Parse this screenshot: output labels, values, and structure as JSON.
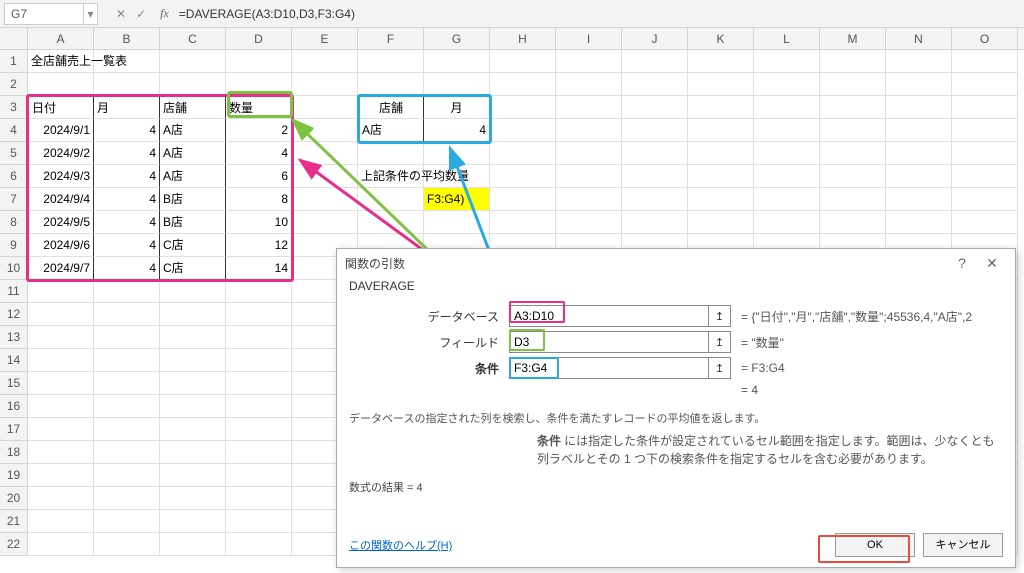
{
  "namebox": "G7",
  "formula": "=DAVERAGE(A3:D10,D3,F3:G4)",
  "cols": [
    "A",
    "B",
    "C",
    "D",
    "E",
    "F",
    "G",
    "H",
    "I",
    "J",
    "K",
    "L",
    "M",
    "N",
    "O"
  ],
  "rows": [
    "1",
    "2",
    "3",
    "4",
    "5",
    "6",
    "7",
    "8",
    "9",
    "10",
    "11",
    "12",
    "13",
    "14",
    "15",
    "16",
    "17",
    "18",
    "19",
    "20",
    "21",
    "22"
  ],
  "r1A": "全店舗売上一覧表",
  "hdr": {
    "A": "日付",
    "B": "月",
    "C": "店舗",
    "D": "数量"
  },
  "tbl": [
    {
      "A": "2024/9/1",
      "B": "4",
      "C": "A店",
      "D": "2"
    },
    {
      "A": "2024/9/2",
      "B": "4",
      "C": "A店",
      "D": "4"
    },
    {
      "A": "2024/9/3",
      "B": "4",
      "C": "A店",
      "D": "6"
    },
    {
      "A": "2024/9/4",
      "B": "4",
      "C": "B店",
      "D": "8"
    },
    {
      "A": "2024/9/5",
      "B": "4",
      "C": "B店",
      "D": "10"
    },
    {
      "A": "2024/9/6",
      "B": "4",
      "C": "C店",
      "D": "12"
    },
    {
      "A": "2024/9/7",
      "B": "4",
      "C": "C店",
      "D": "14"
    }
  ],
  "crit": {
    "F3": "店舗",
    "G3": "月",
    "F4": "A店",
    "G4": "4"
  },
  "lbl_F6": "上記条件の平均数量",
  "G7": "F3:G4)",
  "dlg": {
    "title": "関数の引数",
    "fn": "DAVERAGE",
    "args": [
      {
        "label": "データベース",
        "val": "A3:D10",
        "res": "= {\"日付\",\"月\",\"店舗\",\"数量\";45536,4,\"A店\",2"
      },
      {
        "label": "フィールド",
        "val": "D3",
        "res": "= \"数量\""
      },
      {
        "label": "条件",
        "val": "F3:G4",
        "res": "= F3:G4"
      }
    ],
    "eq4": "= 4",
    "desc": "データベースの指定された列を検索し、条件を満たすレコードの平均値を返します。",
    "argdesc_lbl": "条件",
    "argdesc_txt": "には指定した条件が設定されているセル範囲を指定します。範囲は、少なくとも列ラベルとその 1 つ下の検索条件を指定するセルを含む必要があります。",
    "result": "数式の結果 = 4",
    "help": "この関数のヘルプ(H)",
    "ok": "OK",
    "cancel": "キャンセル"
  }
}
